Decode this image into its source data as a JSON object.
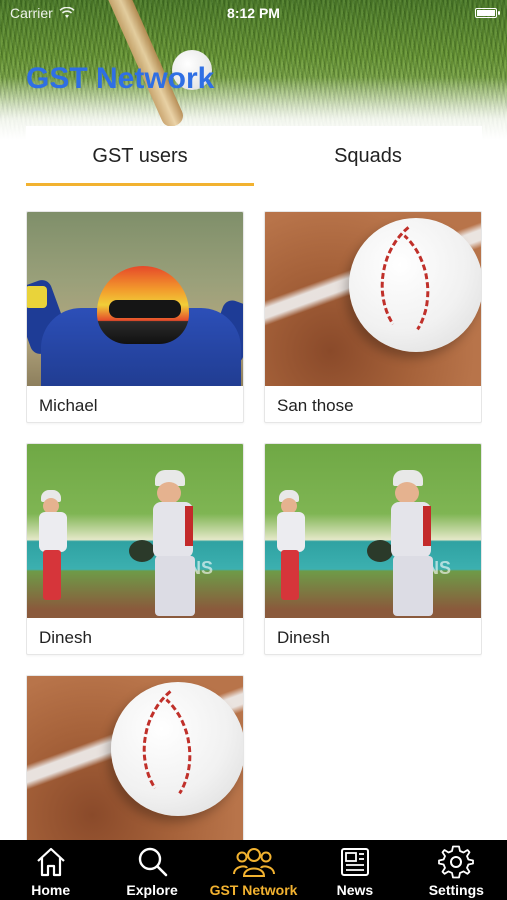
{
  "status_bar": {
    "carrier": "Carrier",
    "time": "8:12 PM"
  },
  "header": {
    "title": "GST Network"
  },
  "tabs": [
    {
      "label": "GST users",
      "active": true
    },
    {
      "label": "Squads",
      "active": false
    }
  ],
  "users": [
    {
      "name": "Michael",
      "photo": "racer-photo"
    },
    {
      "name": "San those",
      "photo": "baseball-photo"
    },
    {
      "name": "Dinesh",
      "photo": "players-photo"
    },
    {
      "name": "Dinesh",
      "photo": "players-photo"
    },
    {
      "name": "",
      "photo": "baseball-photo"
    }
  ],
  "bottom_nav": [
    {
      "label": "Home",
      "icon": "home-icon",
      "active": false
    },
    {
      "label": "Explore",
      "icon": "search-icon",
      "active": false
    },
    {
      "label": "GST Network",
      "icon": "group-icon",
      "active": true
    },
    {
      "label": "News",
      "icon": "newspaper-icon",
      "active": false
    },
    {
      "label": "Settings",
      "icon": "gear-icon",
      "active": false
    }
  ],
  "colors": {
    "title_blue": "#2f6fe4",
    "accent_yellow": "#f2b230",
    "tabbar_bg": "#000000"
  }
}
